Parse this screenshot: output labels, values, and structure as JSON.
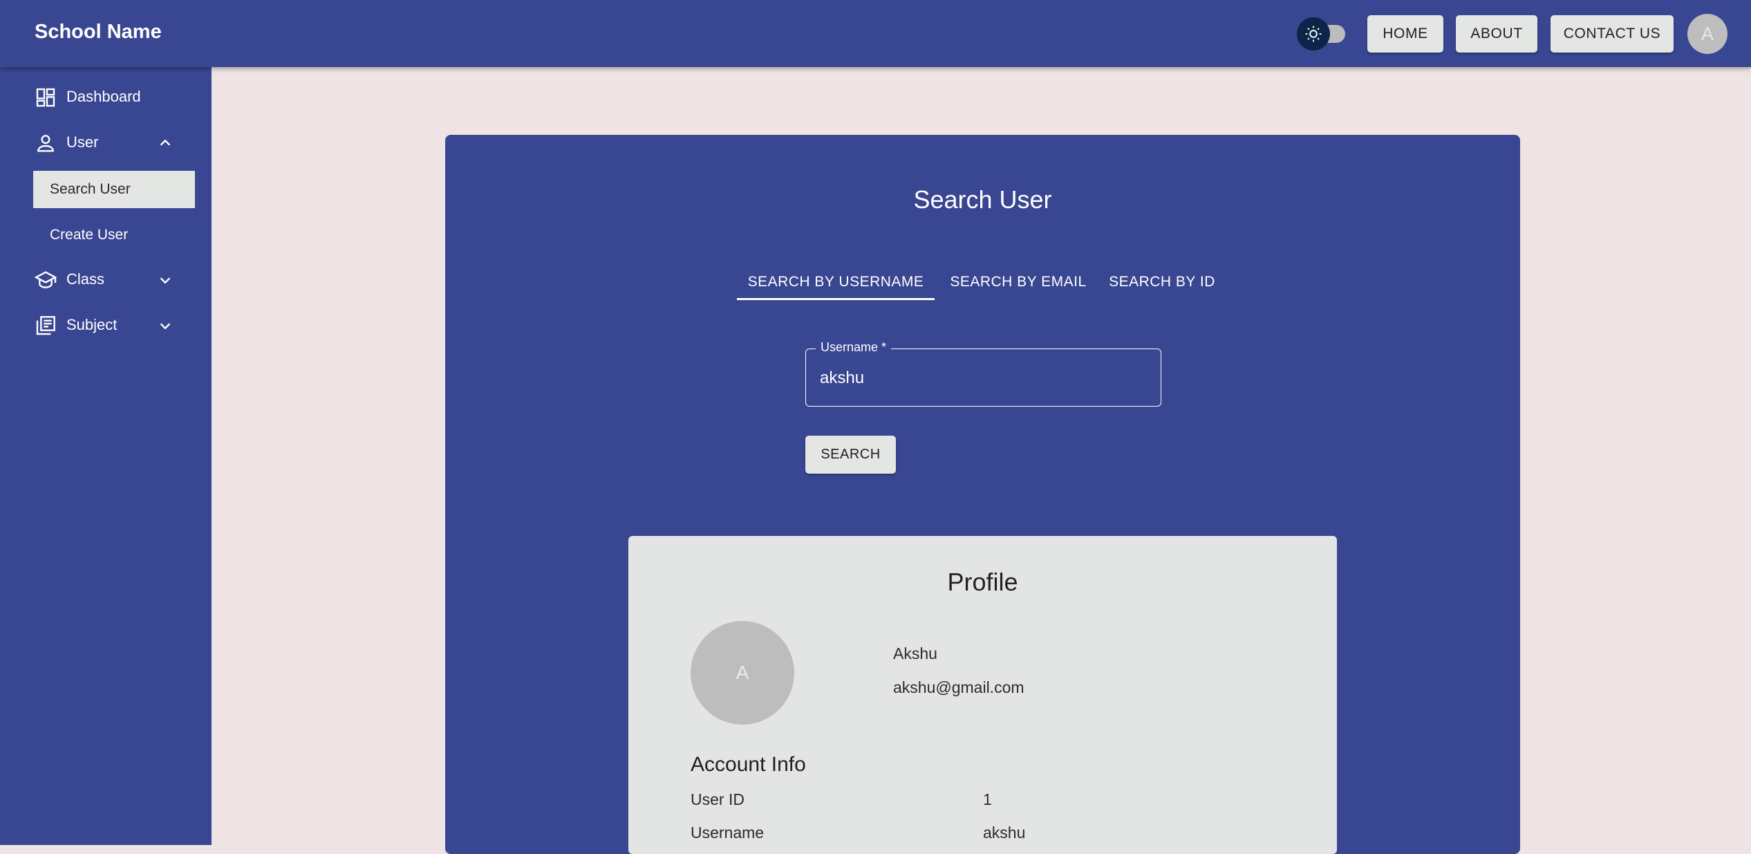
{
  "appbar": {
    "brand": "School Name",
    "nav": {
      "home": "HOME",
      "about": "ABOUT",
      "contact": "CONTACT US"
    },
    "avatar_initial": "A",
    "theme_toggle_icon": "sun-icon"
  },
  "sidebar": {
    "items": [
      {
        "label": "Dashboard",
        "icon": "dashboard-icon"
      },
      {
        "label": "User",
        "icon": "person-icon",
        "expanded": true,
        "children": [
          {
            "label": "Search User",
            "active": true
          },
          {
            "label": "Create User"
          }
        ]
      },
      {
        "label": "Class",
        "icon": "school-icon",
        "expanded": false
      },
      {
        "label": "Subject",
        "icon": "library-books-icon",
        "expanded": false
      }
    ]
  },
  "search_panel": {
    "title": "Search User",
    "tabs": [
      {
        "label": "SEARCH BY USERNAME",
        "active": true
      },
      {
        "label": "SEARCH BY EMAIL"
      },
      {
        "label": "SEARCH BY ID"
      }
    ],
    "field": {
      "label": "Username *",
      "value": "akshu"
    },
    "search_button": "SEARCH"
  },
  "profile": {
    "title": "Profile",
    "avatar_initial": "A",
    "name": "Akshu",
    "email": "akshu@gmail.com",
    "account_info_title": "Account Info",
    "rows": [
      {
        "label": "User ID",
        "value": "1"
      },
      {
        "label": "Username",
        "value": "akshu"
      }
    ]
  },
  "colors": {
    "primary": "#394691",
    "page_background": "#efe3e3",
    "surface": "#e3e5e4",
    "button": "#e4e6e4",
    "toggle_thumb": "#0d2548"
  }
}
